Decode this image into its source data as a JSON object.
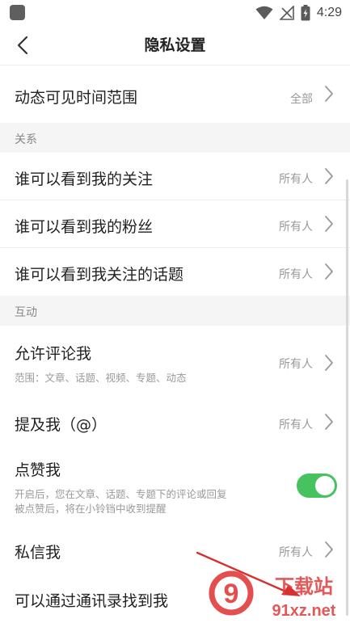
{
  "status_bar": {
    "time": "4:29"
  },
  "header": {
    "title": "隐私设置"
  },
  "rows": {
    "feed_visibility": {
      "label": "动态可见时间范围",
      "value": "全部"
    },
    "who_follows": {
      "label": "谁可以看到我的关注",
      "value": "所有人"
    },
    "who_fans": {
      "label": "谁可以看到我的粉丝",
      "value": "所有人"
    },
    "who_topics": {
      "label": "谁可以看到我关注的话题",
      "value": "所有人"
    },
    "allow_comment": {
      "label": "允许评论我",
      "desc": "范围：文章、话题、视频、专题、动态",
      "value": "所有人"
    },
    "mention_me": {
      "label": "提及我（@）",
      "value": "所有人"
    },
    "like_me": {
      "label": "点赞我",
      "desc_line1": "开启后，您在文章、话题、专题下的评论或回复",
      "desc_line2": "被点赞后，将在小铃铛中收到提醒",
      "enabled": true
    },
    "private_message": {
      "label": "私信我",
      "value": "所有人"
    },
    "find_by_contacts": {
      "label": "可以通过通讯录找到我"
    }
  },
  "sections": {
    "relations": "关系",
    "interaction": "互动"
  },
  "watermark": {
    "logo_text": "9",
    "brand_line1": "下载站",
    "brand_line2": "91xz.net"
  },
  "colors": {
    "toggle_on": "#46c35f",
    "watermark_red": "#e23b3b"
  }
}
